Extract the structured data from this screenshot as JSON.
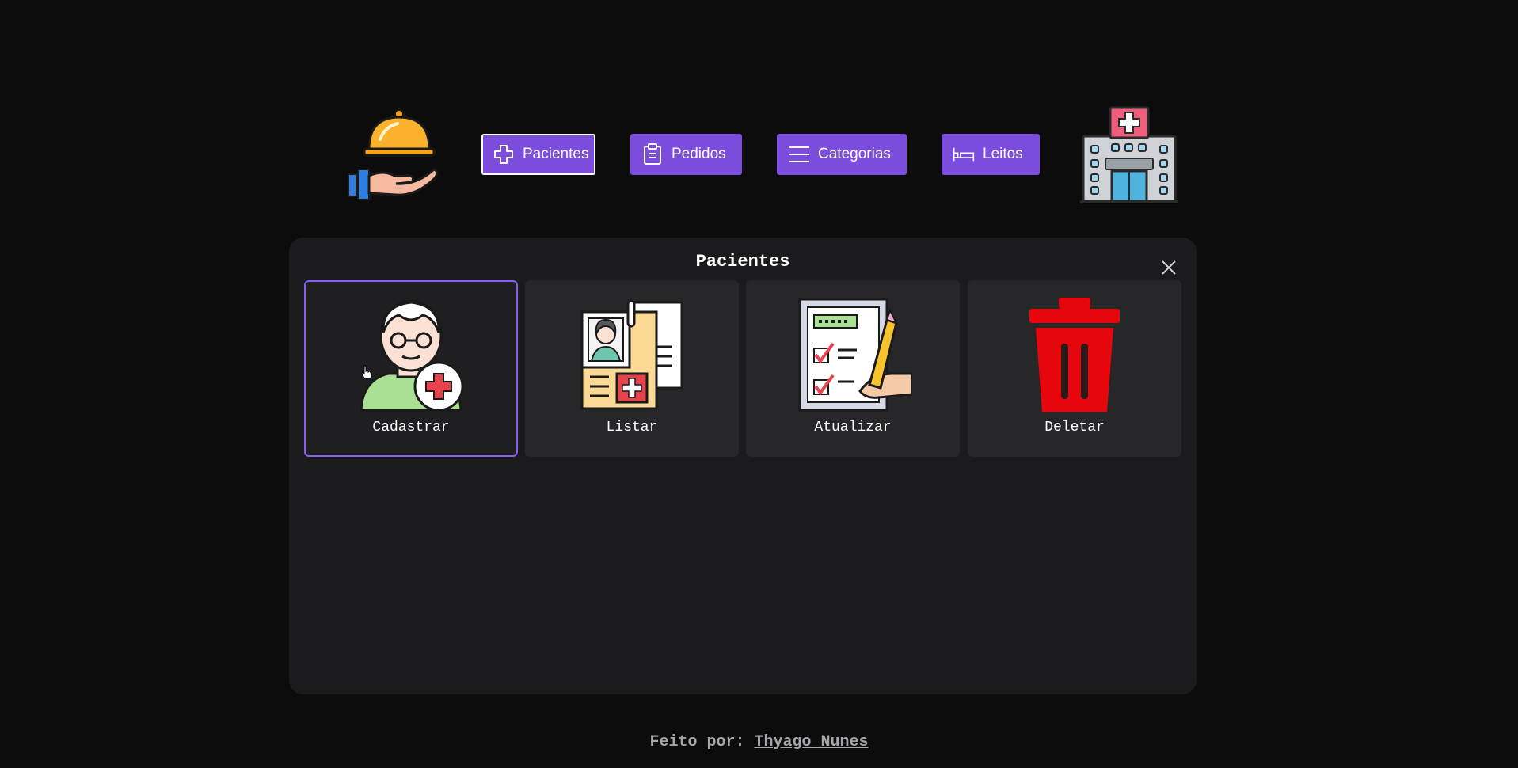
{
  "nav": {
    "buttons": [
      {
        "label": "Pacientes",
        "icon": "plus-outline-icon",
        "active": true
      },
      {
        "label": "Pedidos",
        "icon": "clipboard-icon",
        "active": false
      },
      {
        "label": "Categorias",
        "icon": "menu-lines-icon",
        "active": false
      },
      {
        "label": "Leitos",
        "icon": "bed-icon",
        "active": false
      }
    ],
    "left_logo_icon": "food-serving-hand-icon",
    "right_logo_icon": "hospital-building-icon"
  },
  "panel": {
    "title": "Pacientes",
    "close_icon": "close-icon",
    "actions": [
      {
        "label": "Cadastrar",
        "icon": "elderly-patient-add-icon",
        "selected": true
      },
      {
        "label": "Listar",
        "icon": "patient-records-icon",
        "selected": false
      },
      {
        "label": "Atualizar",
        "icon": "checklist-edit-icon",
        "selected": false
      },
      {
        "label": "Deletar",
        "icon": "trash-icon",
        "selected": false
      }
    ]
  },
  "footer": {
    "prefix": "Feito por: ",
    "author": "Thyago Nunes"
  },
  "colors": {
    "background": "#0c0c0d",
    "panel": "#1b1b1d",
    "card": "#27272a",
    "accent": "#7c4ddc",
    "delete_red": "#e8060d"
  }
}
